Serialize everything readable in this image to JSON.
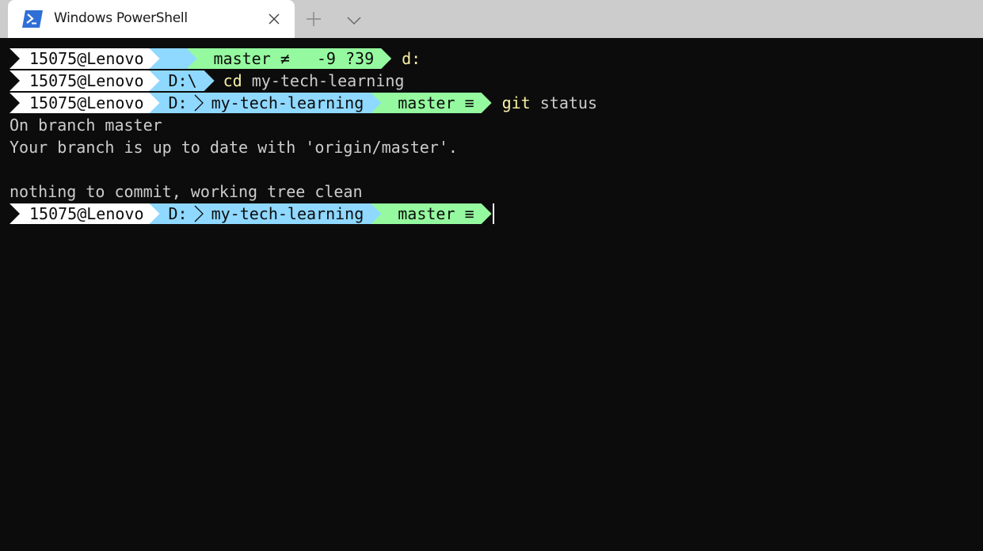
{
  "tab": {
    "title": "Windows PowerShell",
    "icon": "powershell-icon"
  },
  "tabbar": {
    "close_icon": "close-icon",
    "new_tab_icon": "plus-icon",
    "dropdown_icon": "chevron-down-icon"
  },
  "colors": {
    "terminal_bg": "#0c0c0c",
    "user_segment": "#ffffff",
    "path_segment": "#8fd8ff",
    "git_segment": "#95fa9f",
    "command": "#f9f1a5",
    "text": "#cccccc"
  },
  "prompts": [
    {
      "user": "15075@Lenovo",
      "path": "",
      "path_icon": "home-icon",
      "git": {
        "branch": "master",
        "status": "≠",
        "changes": "-9 ?39"
      },
      "command": "d:",
      "args": ""
    },
    {
      "user": "15075@Lenovo",
      "path": "D:\\",
      "command": "cd",
      "args": " my-tech-learning"
    },
    {
      "user": "15075@Lenovo",
      "drive": "D:",
      "folder": "my-tech-learning",
      "git": {
        "branch": "master",
        "status": "≡"
      },
      "command": "git",
      "args": " status"
    },
    {
      "user": "15075@Lenovo",
      "drive": "D:",
      "folder": "my-tech-learning",
      "git": {
        "branch": "master",
        "status": "≡"
      },
      "command": "",
      "args": ""
    }
  ],
  "output": [
    "On branch master",
    "Your branch is up to date with 'origin/master'.",
    "",
    "nothing to commit, working tree clean"
  ]
}
